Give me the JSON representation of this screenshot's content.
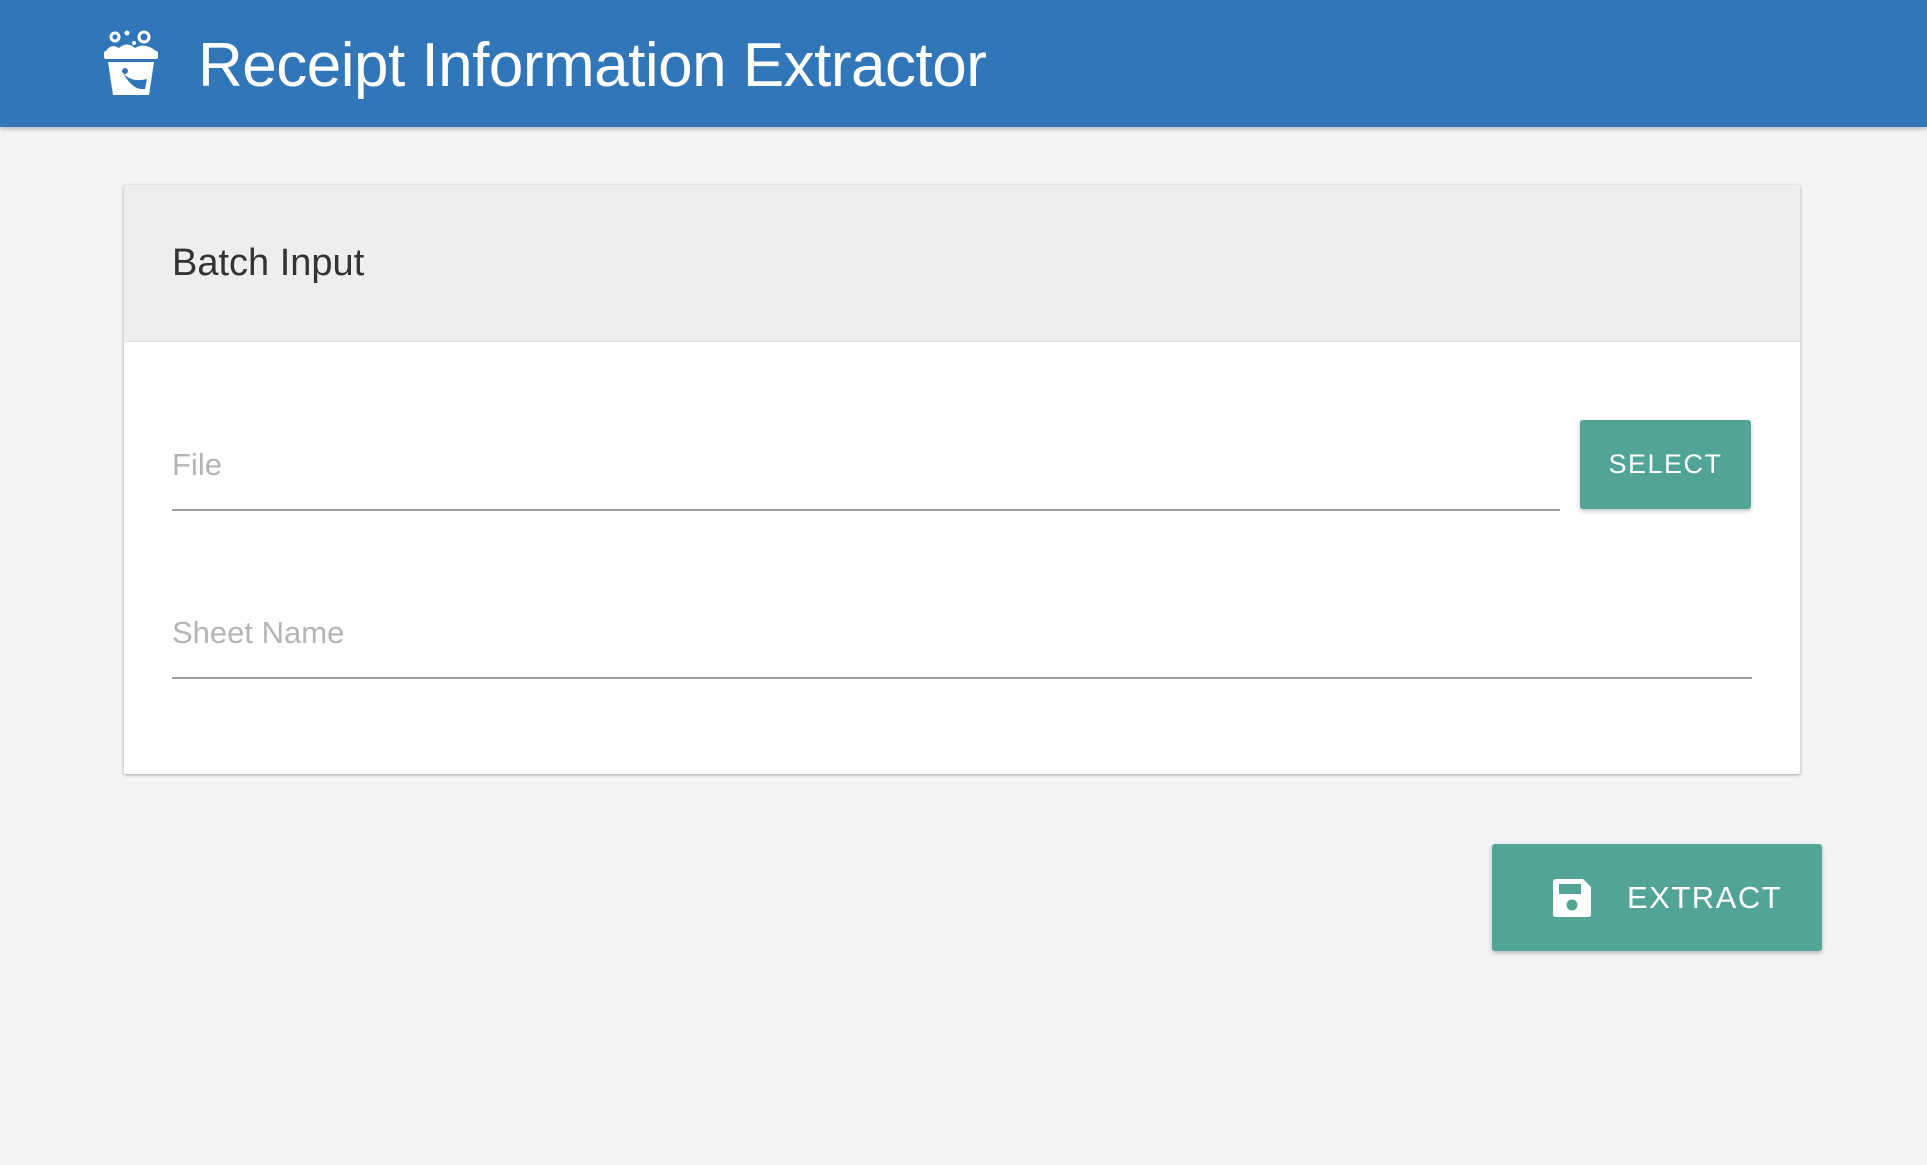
{
  "header": {
    "title": "Receipt Information Extractor",
    "logo_icon": "bucket-icon",
    "background_color": "#3276ba"
  },
  "card": {
    "title": "Batch Input",
    "file_field": {
      "placeholder": "File",
      "value": ""
    },
    "select_button_label": "SELECT",
    "sheet_field": {
      "placeholder": "Sheet Name",
      "value": ""
    }
  },
  "actions": {
    "extract_label": "EXTRACT",
    "extract_icon": "floppy-disk-icon",
    "accent_color": "#52a497"
  }
}
